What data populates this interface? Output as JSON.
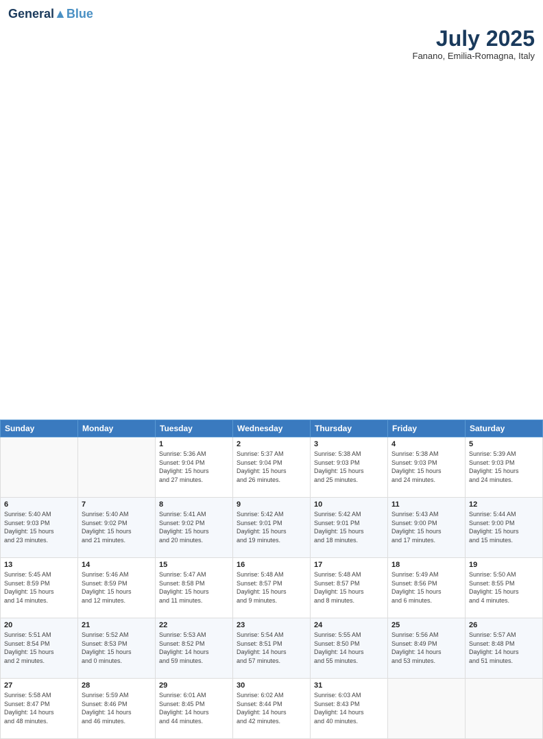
{
  "header": {
    "logo_line1": "General",
    "logo_line2": "Blue",
    "month": "July 2025",
    "location": "Fanano, Emilia-Romagna, Italy"
  },
  "weekdays": [
    "Sunday",
    "Monday",
    "Tuesday",
    "Wednesday",
    "Thursday",
    "Friday",
    "Saturday"
  ],
  "weeks": [
    [
      {
        "day": "",
        "info": ""
      },
      {
        "day": "",
        "info": ""
      },
      {
        "day": "1",
        "info": "Sunrise: 5:36 AM\nSunset: 9:04 PM\nDaylight: 15 hours\nand 27 minutes."
      },
      {
        "day": "2",
        "info": "Sunrise: 5:37 AM\nSunset: 9:04 PM\nDaylight: 15 hours\nand 26 minutes."
      },
      {
        "day": "3",
        "info": "Sunrise: 5:38 AM\nSunset: 9:03 PM\nDaylight: 15 hours\nand 25 minutes."
      },
      {
        "day": "4",
        "info": "Sunrise: 5:38 AM\nSunset: 9:03 PM\nDaylight: 15 hours\nand 24 minutes."
      },
      {
        "day": "5",
        "info": "Sunrise: 5:39 AM\nSunset: 9:03 PM\nDaylight: 15 hours\nand 24 minutes."
      }
    ],
    [
      {
        "day": "6",
        "info": "Sunrise: 5:40 AM\nSunset: 9:03 PM\nDaylight: 15 hours\nand 23 minutes."
      },
      {
        "day": "7",
        "info": "Sunrise: 5:40 AM\nSunset: 9:02 PM\nDaylight: 15 hours\nand 21 minutes."
      },
      {
        "day": "8",
        "info": "Sunrise: 5:41 AM\nSunset: 9:02 PM\nDaylight: 15 hours\nand 20 minutes."
      },
      {
        "day": "9",
        "info": "Sunrise: 5:42 AM\nSunset: 9:01 PM\nDaylight: 15 hours\nand 19 minutes."
      },
      {
        "day": "10",
        "info": "Sunrise: 5:42 AM\nSunset: 9:01 PM\nDaylight: 15 hours\nand 18 minutes."
      },
      {
        "day": "11",
        "info": "Sunrise: 5:43 AM\nSunset: 9:00 PM\nDaylight: 15 hours\nand 17 minutes."
      },
      {
        "day": "12",
        "info": "Sunrise: 5:44 AM\nSunset: 9:00 PM\nDaylight: 15 hours\nand 15 minutes."
      }
    ],
    [
      {
        "day": "13",
        "info": "Sunrise: 5:45 AM\nSunset: 8:59 PM\nDaylight: 15 hours\nand 14 minutes."
      },
      {
        "day": "14",
        "info": "Sunrise: 5:46 AM\nSunset: 8:59 PM\nDaylight: 15 hours\nand 12 minutes."
      },
      {
        "day": "15",
        "info": "Sunrise: 5:47 AM\nSunset: 8:58 PM\nDaylight: 15 hours\nand 11 minutes."
      },
      {
        "day": "16",
        "info": "Sunrise: 5:48 AM\nSunset: 8:57 PM\nDaylight: 15 hours\nand 9 minutes."
      },
      {
        "day": "17",
        "info": "Sunrise: 5:48 AM\nSunset: 8:57 PM\nDaylight: 15 hours\nand 8 minutes."
      },
      {
        "day": "18",
        "info": "Sunrise: 5:49 AM\nSunset: 8:56 PM\nDaylight: 15 hours\nand 6 minutes."
      },
      {
        "day": "19",
        "info": "Sunrise: 5:50 AM\nSunset: 8:55 PM\nDaylight: 15 hours\nand 4 minutes."
      }
    ],
    [
      {
        "day": "20",
        "info": "Sunrise: 5:51 AM\nSunset: 8:54 PM\nDaylight: 15 hours\nand 2 minutes."
      },
      {
        "day": "21",
        "info": "Sunrise: 5:52 AM\nSunset: 8:53 PM\nDaylight: 15 hours\nand 0 minutes."
      },
      {
        "day": "22",
        "info": "Sunrise: 5:53 AM\nSunset: 8:52 PM\nDaylight: 14 hours\nand 59 minutes."
      },
      {
        "day": "23",
        "info": "Sunrise: 5:54 AM\nSunset: 8:51 PM\nDaylight: 14 hours\nand 57 minutes."
      },
      {
        "day": "24",
        "info": "Sunrise: 5:55 AM\nSunset: 8:50 PM\nDaylight: 14 hours\nand 55 minutes."
      },
      {
        "day": "25",
        "info": "Sunrise: 5:56 AM\nSunset: 8:49 PM\nDaylight: 14 hours\nand 53 minutes."
      },
      {
        "day": "26",
        "info": "Sunrise: 5:57 AM\nSunset: 8:48 PM\nDaylight: 14 hours\nand 51 minutes."
      }
    ],
    [
      {
        "day": "27",
        "info": "Sunrise: 5:58 AM\nSunset: 8:47 PM\nDaylight: 14 hours\nand 48 minutes."
      },
      {
        "day": "28",
        "info": "Sunrise: 5:59 AM\nSunset: 8:46 PM\nDaylight: 14 hours\nand 46 minutes."
      },
      {
        "day": "29",
        "info": "Sunrise: 6:01 AM\nSunset: 8:45 PM\nDaylight: 14 hours\nand 44 minutes."
      },
      {
        "day": "30",
        "info": "Sunrise: 6:02 AM\nSunset: 8:44 PM\nDaylight: 14 hours\nand 42 minutes."
      },
      {
        "day": "31",
        "info": "Sunrise: 6:03 AM\nSunset: 8:43 PM\nDaylight: 14 hours\nand 40 minutes."
      },
      {
        "day": "",
        "info": ""
      },
      {
        "day": "",
        "info": ""
      }
    ]
  ]
}
